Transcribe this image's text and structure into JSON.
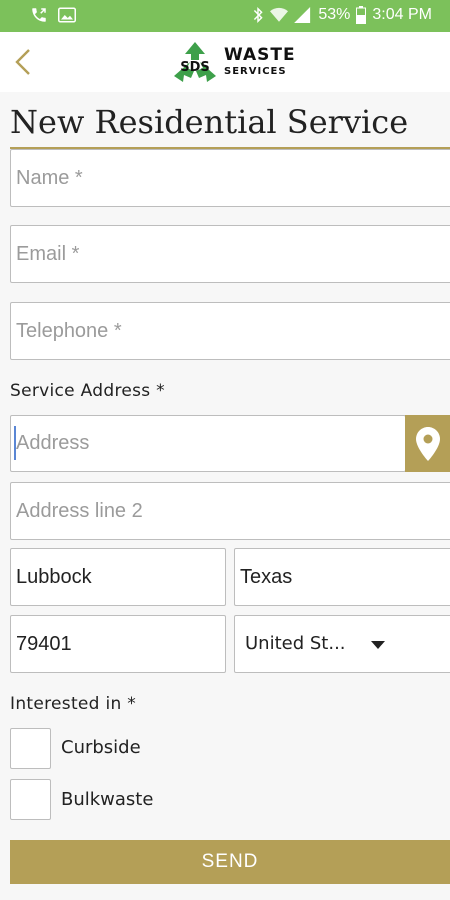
{
  "status_bar": {
    "battery": "53%",
    "time": "3:04 PM",
    "background_color": "#7cc15b"
  },
  "header": {
    "logo_initials": "SDS",
    "logo_word1": "WASTE",
    "logo_word2": "SERVICES",
    "back_icon": "chevron-left-icon",
    "accent_color": "#b49f57"
  },
  "form": {
    "title": "New Residential Service",
    "name_placeholder": "Name *",
    "email_placeholder": "Email *",
    "telephone_placeholder": "Telephone *",
    "service_address_label": "Service Address *",
    "address_placeholder": "Address",
    "address_line2_placeholder": "Address line 2",
    "city_value": "Lubbock",
    "state_value": "Texas",
    "zip_value": "79401",
    "country_value": "United St...",
    "interested_label": "Interested in *",
    "options": [
      "Curbside",
      "Bulkwaste"
    ],
    "send_label": "SEND"
  }
}
